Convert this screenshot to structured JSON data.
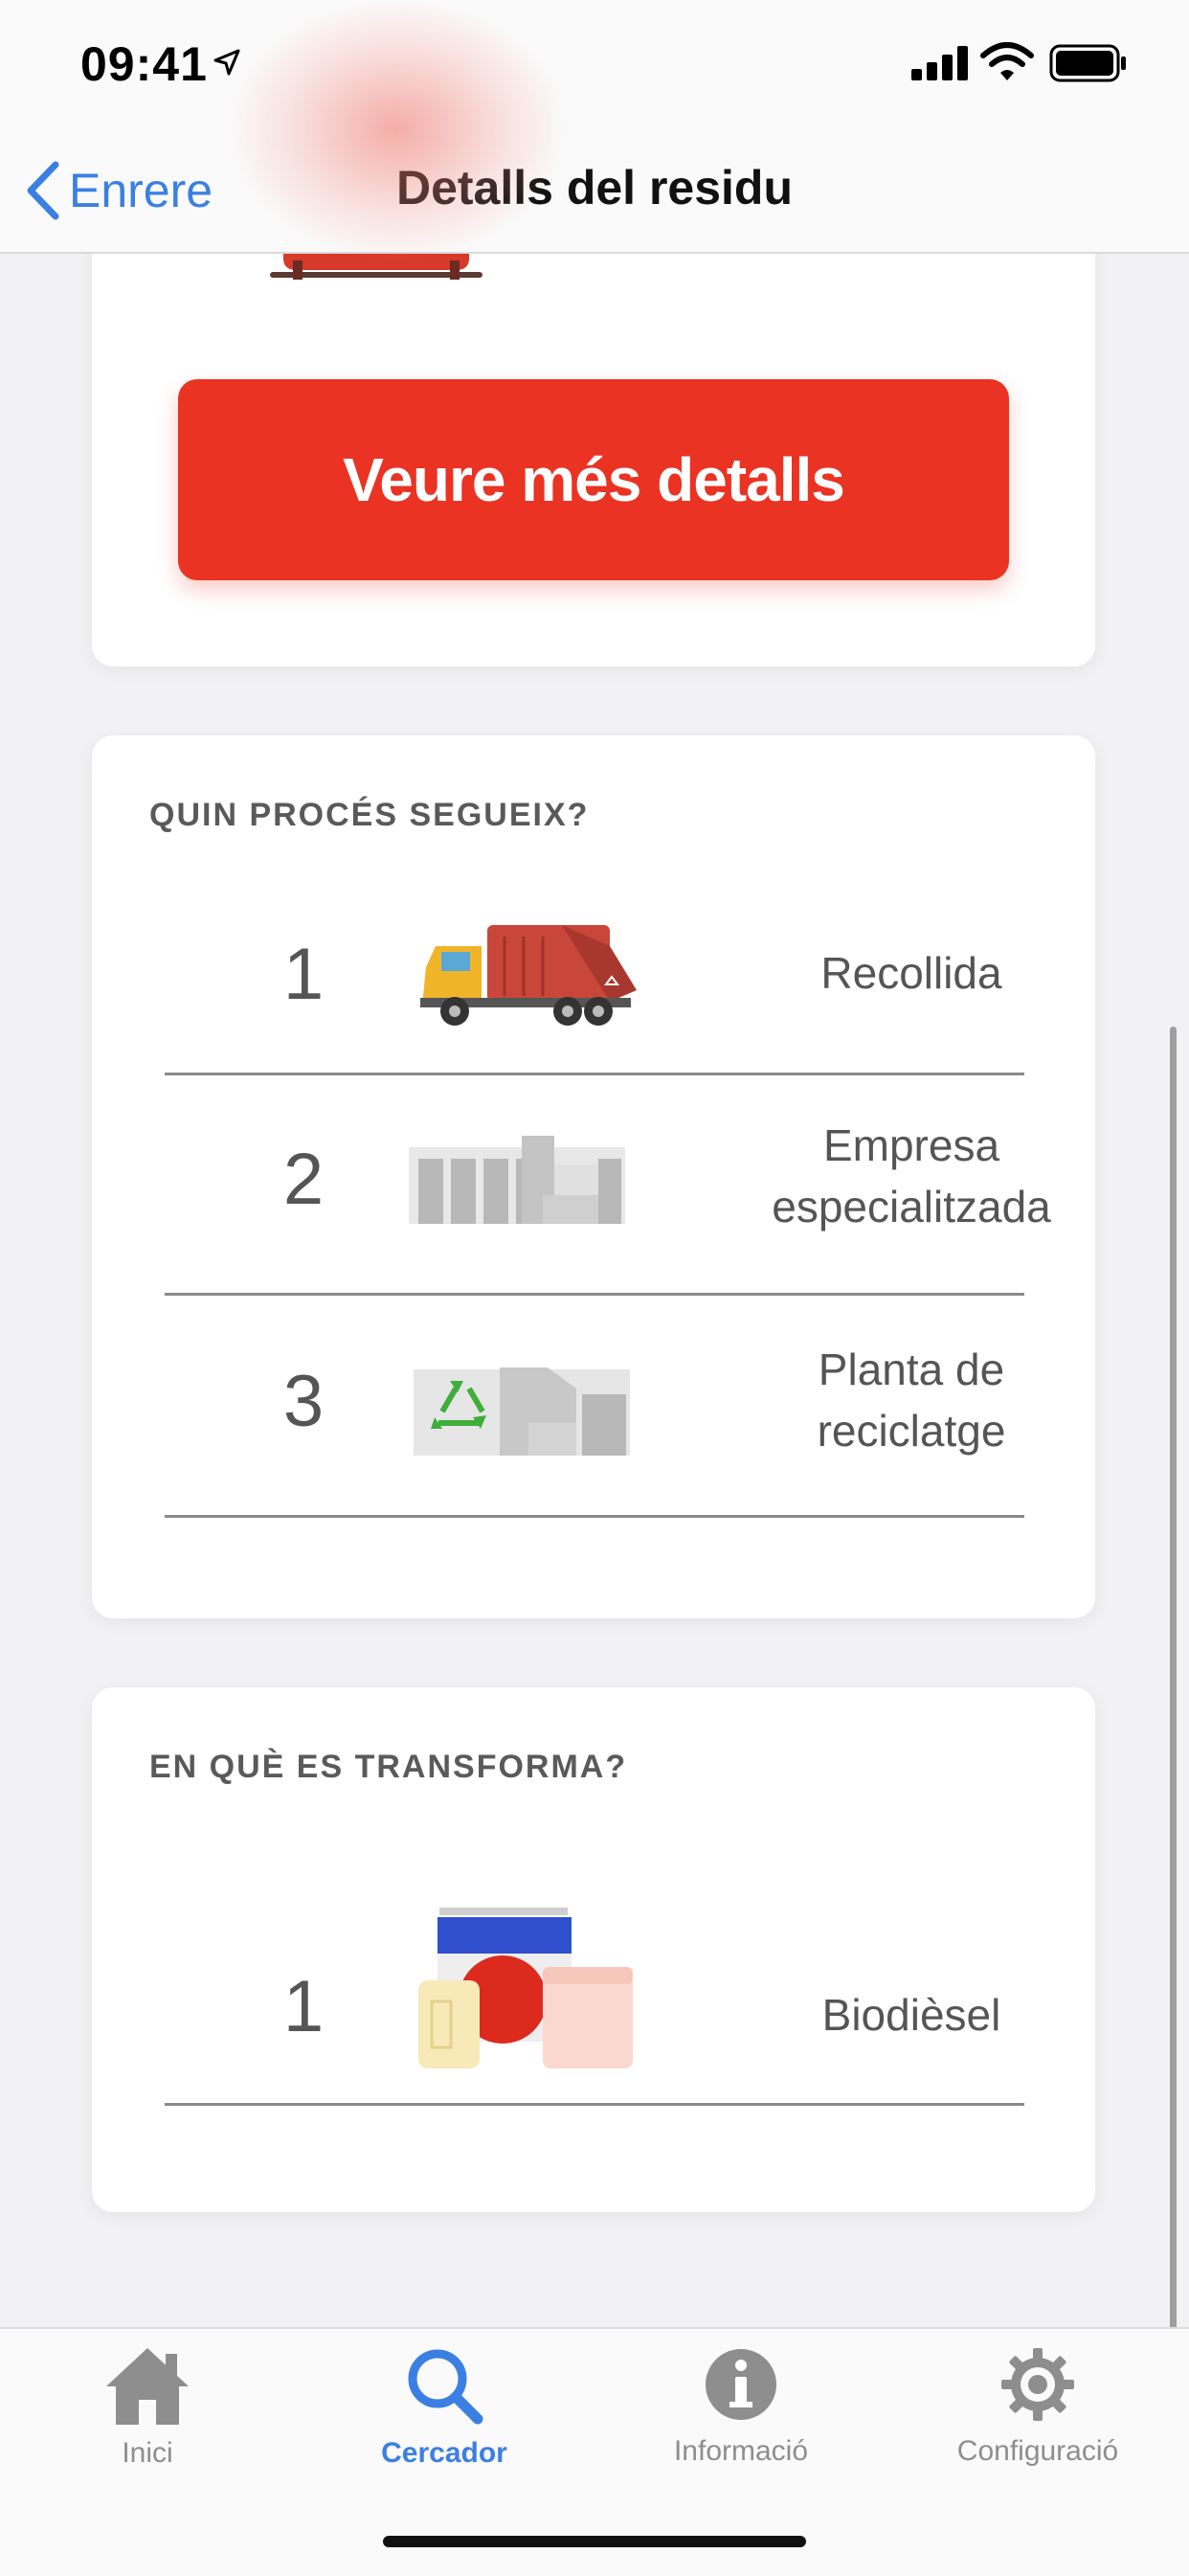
{
  "status_bar": {
    "time": "09:41"
  },
  "nav": {
    "back_label": "Enrere",
    "title": "Detalls del residu"
  },
  "details_button": {
    "label": "Veure més detalls"
  },
  "process": {
    "title": "QUIN PROCÉS SEGUEIX?",
    "steps": [
      {
        "number": "1",
        "line1": "Recollida",
        "line2": "",
        "icon": "garbage-truck-icon"
      },
      {
        "number": "2",
        "line1": "Empresa",
        "line2": "especialitzada",
        "icon": "factory-icon"
      },
      {
        "number": "3",
        "line1": "Planta de",
        "line2": "reciclatge",
        "icon": "recycling-plant-icon"
      }
    ]
  },
  "transform": {
    "title": "EN QUÈ ES TRANSFORMA?",
    "items": [
      {
        "number": "1",
        "label": "Biodièsel",
        "icon": "products-icon"
      }
    ]
  },
  "tabs": [
    {
      "label": "Inici",
      "icon": "home-icon",
      "active": false
    },
    {
      "label": "Cercador",
      "icon": "search-icon",
      "active": true
    },
    {
      "label": "Informació",
      "icon": "info-icon",
      "active": false
    },
    {
      "label": "Configuració",
      "icon": "gear-icon",
      "active": false
    }
  ],
  "colors": {
    "accent": "#3b7fe3",
    "button_red": "#ea3323",
    "inactive_gray": "#8e8e8e"
  }
}
